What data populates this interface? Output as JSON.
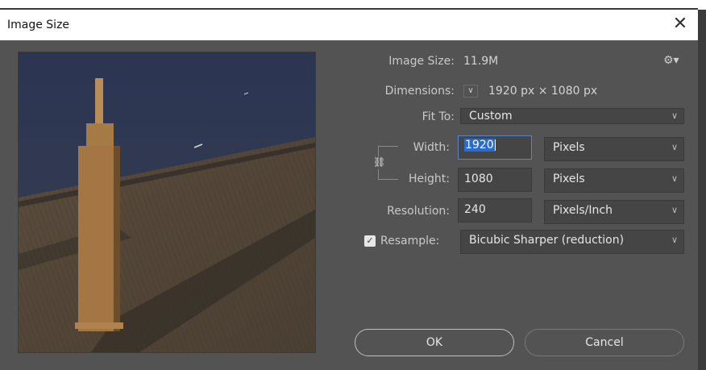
{
  "dialog": {
    "title": "Image Size",
    "close_icon": "close-icon"
  },
  "info": {
    "image_size_label": "Image Size:",
    "image_size_value": "11.9M",
    "dimensions_label": "Dimensions:",
    "dimensions_value": "1920 px  ×  1080 px",
    "settings_icon": "gear-icon"
  },
  "fit_to": {
    "label": "Fit To:",
    "value": "Custom"
  },
  "width": {
    "label": "Width:",
    "value": "1920",
    "unit": "Pixels"
  },
  "height": {
    "label": "Height:",
    "value": "1080",
    "unit": "Pixels"
  },
  "resolution": {
    "label": "Resolution:",
    "value": "240",
    "unit": "Pixels/Inch"
  },
  "resample": {
    "label": "Resample:",
    "checked": true,
    "value": "Bicubic Sharper (reduction)"
  },
  "buttons": {
    "ok": "OK",
    "cancel": "Cancel"
  },
  "colors": {
    "dialog_bg": "#535353",
    "field_bg": "#454545",
    "selection": "#2a6bd1"
  }
}
